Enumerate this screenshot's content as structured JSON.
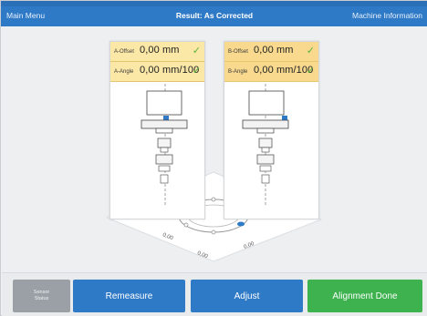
{
  "nav": {
    "left": "Main Menu",
    "title": "Result: As Corrected",
    "right": "Machine Information"
  },
  "panel_a": {
    "rows": [
      {
        "label": "A-Offset",
        "value": "0,00 mm"
      },
      {
        "label": "A-Angle",
        "value": "0,00 mm/100"
      }
    ]
  },
  "panel_b": {
    "rows": [
      {
        "label": "B-Offset",
        "value": "0,00 mm"
      },
      {
        "label": "B-Angle",
        "value": "0,00 mm/100"
      }
    ]
  },
  "floor": {
    "values": [
      "0,00",
      "0,00",
      "0,00",
      "0,00",
      "0,00",
      "0,00"
    ]
  },
  "buttons": {
    "sensor_line1": "Sensor",
    "sensor_line2": "Status",
    "remeasure": "Remeasure",
    "adjust": "Adjust",
    "done": "Alignment Done"
  },
  "colors": {
    "nav": "#2f7ac6",
    "button_blue": "#2f7ac6",
    "button_green": "#3db24e",
    "button_gray": "#9aa0a5",
    "check_green": "#58b33b",
    "value_panel_a": "#fbe7a6",
    "value_panel_b": "#f8d98d"
  }
}
